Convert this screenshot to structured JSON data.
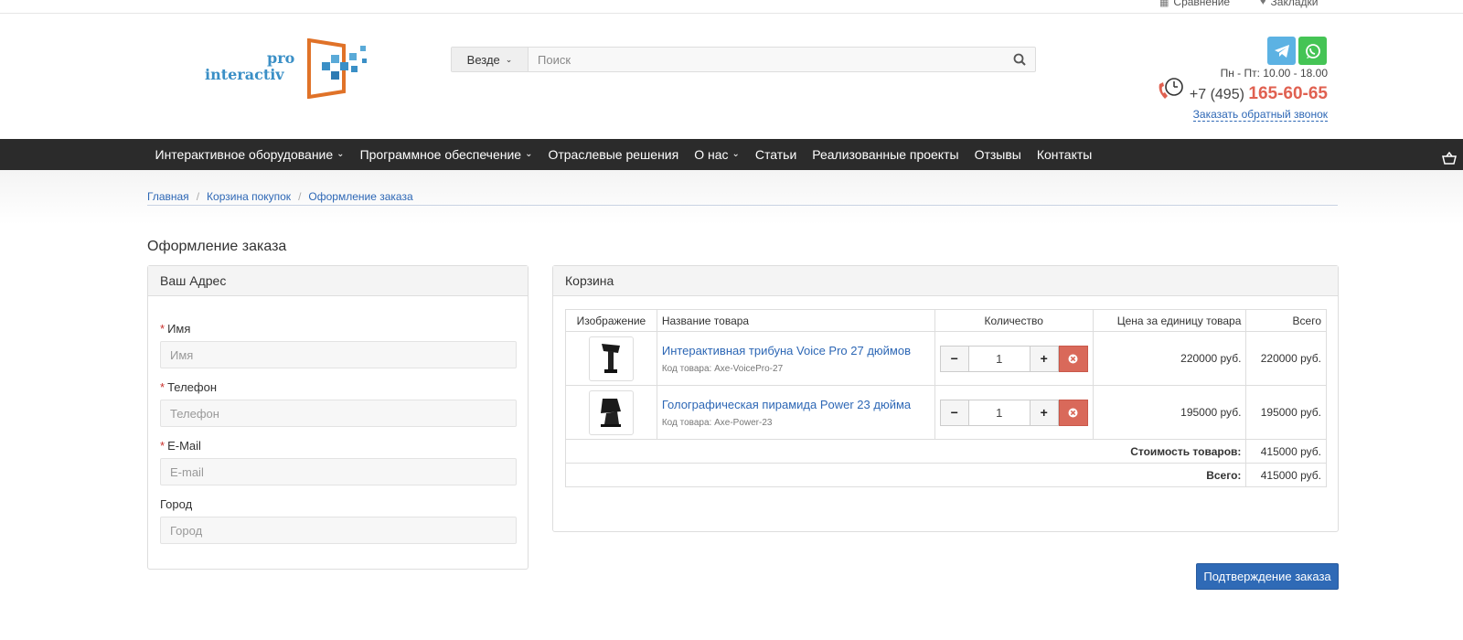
{
  "topbar": {
    "compare": "Сравнение",
    "bookmarks": "Закладки"
  },
  "logo": {
    "line1": "pro",
    "line2": "interactiv"
  },
  "search": {
    "scope": "Везде",
    "placeholder": "Поиск"
  },
  "contacts": {
    "hours": "Пн - Пт: 10.00 - 18.00",
    "phone_prefix": "+7 (495)",
    "phone_main": "165-60-65",
    "callback": "Заказать обратный звонок"
  },
  "nav": [
    {
      "label": "Интерактивное оборудование",
      "dropdown": true
    },
    {
      "label": "Программное обеспечение",
      "dropdown": true
    },
    {
      "label": "Отраслевые решения",
      "dropdown": false
    },
    {
      "label": "О нас",
      "dropdown": true
    },
    {
      "label": "Статьи",
      "dropdown": false
    },
    {
      "label": "Реализованные проекты",
      "dropdown": false
    },
    {
      "label": "Отзывы",
      "dropdown": false
    },
    {
      "label": "Контакты",
      "dropdown": false
    }
  ],
  "breadcrumb": [
    "Главная",
    "Корзина покупок",
    "Оформление заказа"
  ],
  "page_title": "Оформление заказа",
  "address": {
    "title": "Ваш Адрес",
    "fields": [
      {
        "label": "Имя",
        "placeholder": "Имя",
        "required": true
      },
      {
        "label": "Телефон",
        "placeholder": "Телефон",
        "required": true
      },
      {
        "label": "E-Mail",
        "placeholder": "E-mail",
        "required": true
      },
      {
        "label": "Город",
        "placeholder": "Город",
        "required": false
      }
    ]
  },
  "cart": {
    "title": "Корзина",
    "headers": [
      "Изображение",
      "Название товара",
      "Количество",
      "Цена за единицу товара",
      "Всего"
    ],
    "items": [
      {
        "name": "Интерактивная трибуна Voice Pro 27 дюймов",
        "code": "Код товара: Axe-VoicePro-27",
        "qty": "1",
        "price": "220000 руб.",
        "total": "220000 руб."
      },
      {
        "name": "Голографическая пирамида Power 23 дюйма",
        "code": "Код товара: Axe-Power-23",
        "qty": "1",
        "price": "195000 руб.",
        "total": "195000 руб."
      }
    ],
    "subtotal_label": "Стоимость товаров:",
    "subtotal": "415000 руб.",
    "total_label": "Всего:",
    "total": "415000 руб."
  },
  "confirm_button": "Подтверждение заказа",
  "colors": {
    "nav_bg": "#2b2b2b",
    "link": "#2d67b5",
    "accent_phone": "#e06151",
    "confirm": "#2f6ab6",
    "remove": "#d9695a"
  }
}
